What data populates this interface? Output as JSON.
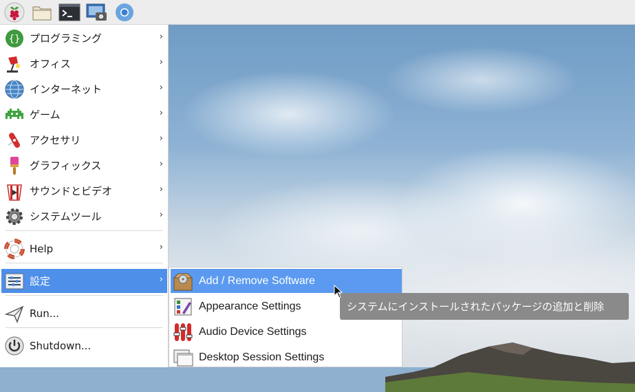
{
  "panel": {
    "launchers": [
      "raspberry-menu-icon",
      "file-manager-icon",
      "terminal-icon",
      "screenshot-icon",
      "chromium-icon"
    ]
  },
  "menu": {
    "items": [
      {
        "label": "プログラミング",
        "icon": "programming-icon"
      },
      {
        "label": "オフィス",
        "icon": "office-icon"
      },
      {
        "label": "インターネット",
        "icon": "internet-icon"
      },
      {
        "label": "ゲーム",
        "icon": "games-icon"
      },
      {
        "label": "アクセサリ",
        "icon": "accessories-icon"
      },
      {
        "label": "グラフィックス",
        "icon": "graphics-icon"
      },
      {
        "label": "サウンドとビデオ",
        "icon": "sound-video-icon"
      },
      {
        "label": "システムツール",
        "icon": "system-tools-icon"
      },
      {
        "label": "Help",
        "icon": "help-icon"
      },
      {
        "label": "設定",
        "icon": "preferences-icon"
      },
      {
        "label": "Run...",
        "icon": "run-icon"
      },
      {
        "label": "Shutdown...",
        "icon": "shutdown-icon"
      }
    ],
    "arrow": "›"
  },
  "submenu": {
    "items": [
      {
        "label": "Add / Remove Software",
        "icon": "add-remove-software-icon"
      },
      {
        "label": "Appearance Settings",
        "icon": "appearance-settings-icon"
      },
      {
        "label": "Audio Device Settings",
        "icon": "audio-device-settings-icon"
      },
      {
        "label": "Desktop Session Settings",
        "icon": "desktop-session-settings-icon"
      }
    ]
  },
  "tooltip": {
    "text": "システムにインストールされたパッケージの追加と削除"
  },
  "colors": {
    "highlight": "#4d8fe9",
    "tooltip_bg": "#8a8a8a",
    "panel_bg": "#ededed"
  }
}
